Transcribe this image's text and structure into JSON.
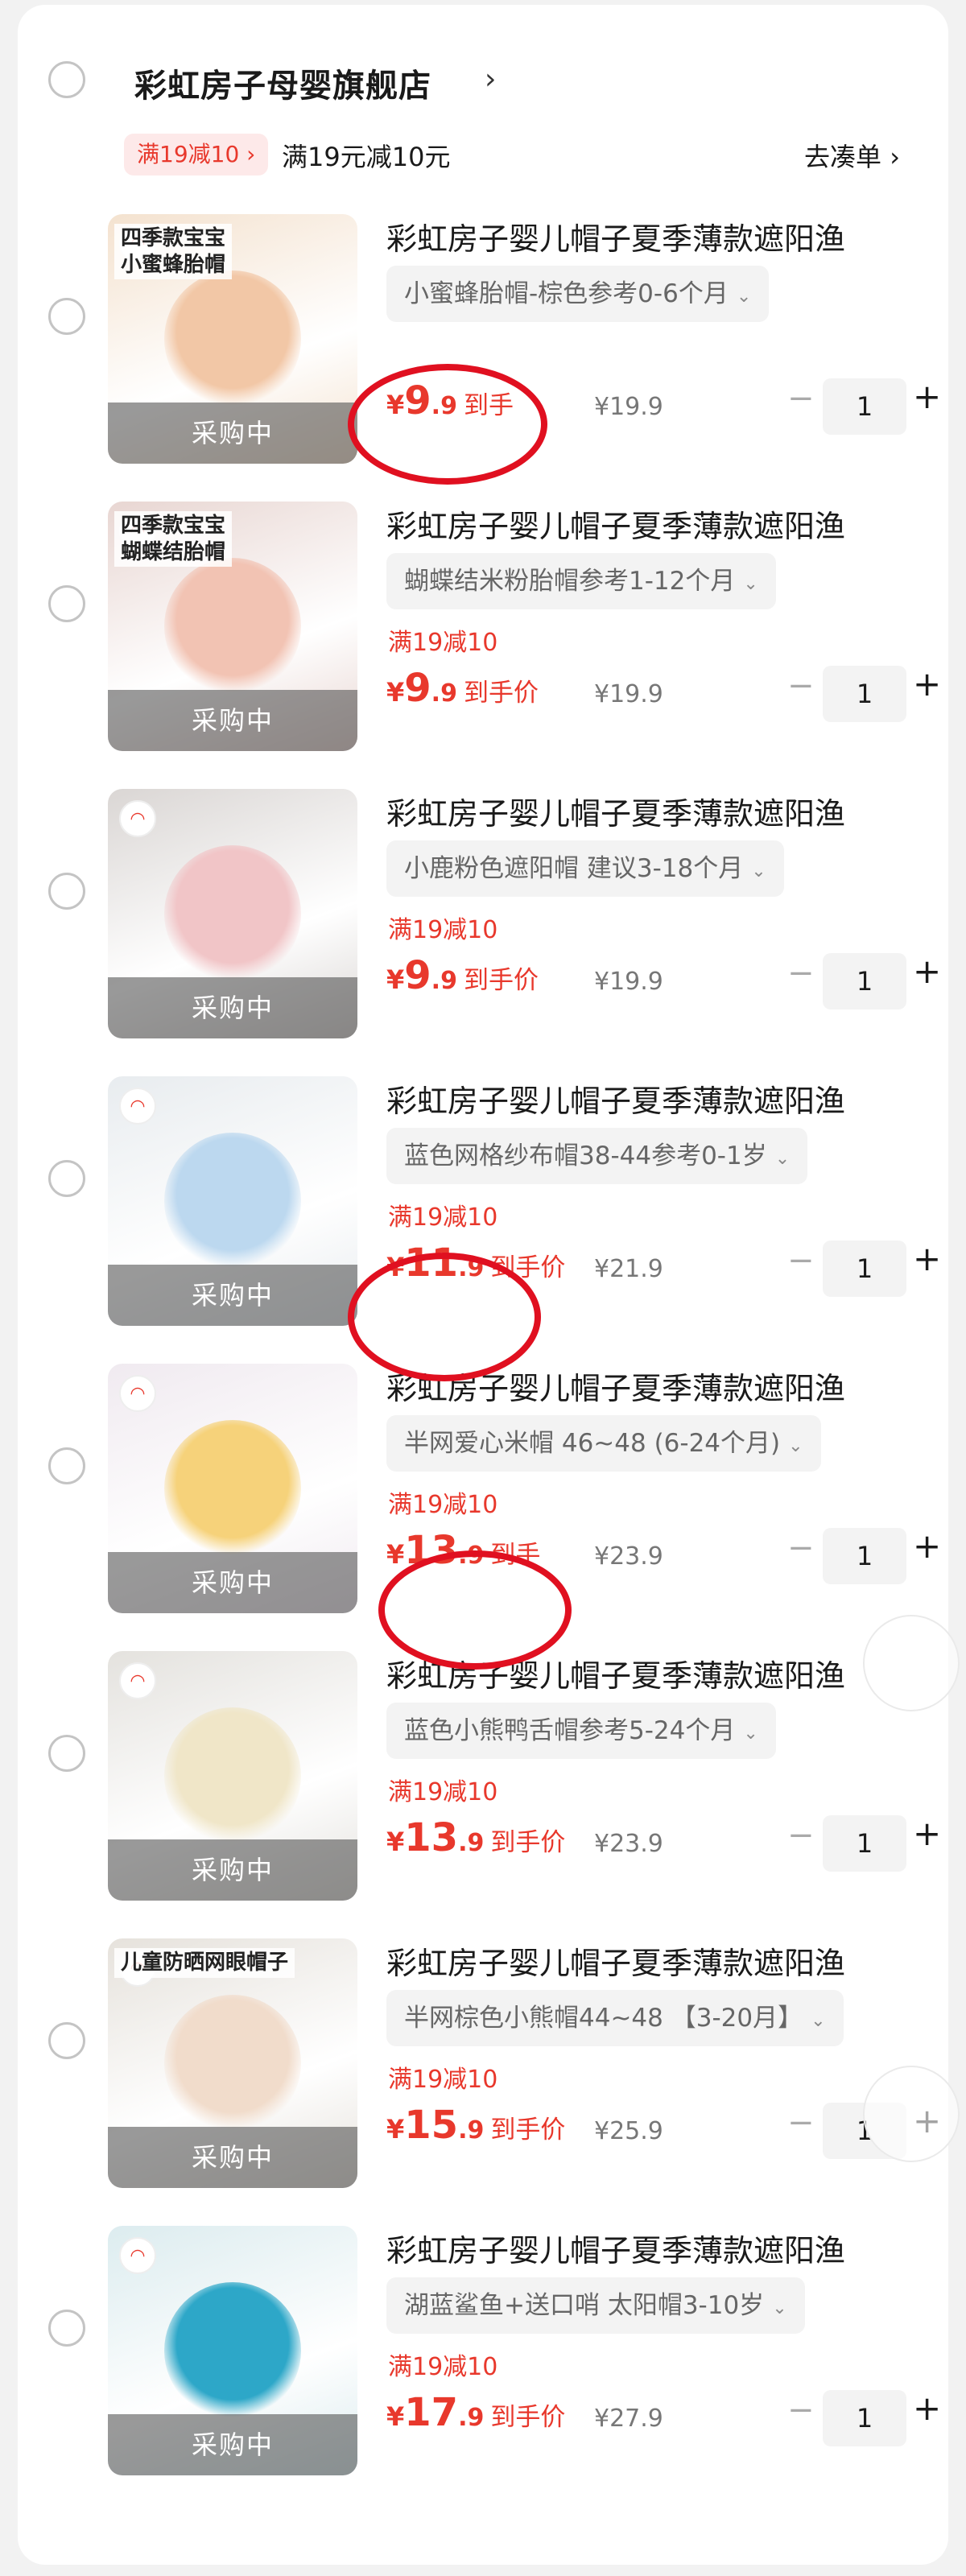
{
  "store": {
    "name": "彩虹房子母婴旗舰店",
    "chevron": "›",
    "promo_badge": "满19减10 ›",
    "promo_text": "满19元减10元",
    "gather_label": "去凑单 ›"
  },
  "colors": {
    "accent": "#e8382c",
    "annotation_red": "#e01020"
  },
  "items": [
    {
      "title": "彩虹房子婴儿帽子夏季薄款遮阳渔",
      "variant": "小蜜蜂胎帽-棕色参考0-6个月",
      "thumb_caption": "四季款宝宝\n小蜜蜂胎帽",
      "thumb_status": "采购中",
      "discount": "",
      "price_yen": "¥",
      "price_int": "9",
      "price_dec": ".9",
      "price_label": "到手",
      "orig_price": "¥19.9",
      "qty": "1"
    },
    {
      "title": "彩虹房子婴儿帽子夏季薄款遮阳渔",
      "variant": "蝴蝶结米粉胎帽参考1-12个月",
      "thumb_caption": "四季款宝宝\n蝴蝶结胎帽",
      "thumb_status": "采购中",
      "discount": "满19减10",
      "price_yen": "¥",
      "price_int": "9",
      "price_dec": ".9",
      "price_label": "到手价",
      "orig_price": "¥19.9",
      "qty": "1"
    },
    {
      "title": "彩虹房子婴儿帽子夏季薄款遮阳渔",
      "variant": "小鹿粉色遮阳帽 建议3-18个月",
      "thumb_caption": "",
      "thumb_status": "采购中",
      "discount": "满19减10",
      "price_yen": "¥",
      "price_int": "9",
      "price_dec": ".9",
      "price_label": "到手价",
      "orig_price": "¥19.9",
      "qty": "1"
    },
    {
      "title": "彩虹房子婴儿帽子夏季薄款遮阳渔",
      "variant": "蓝色网格纱布帽38-44参考0-1岁",
      "thumb_caption": "",
      "thumb_status": "采购中",
      "discount": "满19减10",
      "price_yen": "¥",
      "price_int": "11",
      "price_dec": ".9",
      "price_label": "到手价",
      "orig_price": "¥21.9",
      "qty": "1"
    },
    {
      "title": "彩虹房子婴儿帽子夏季薄款遮阳渔",
      "variant": "半网爱心米帽 46~48 (6-24个月)",
      "thumb_caption": "",
      "thumb_status": "采购中",
      "discount": "满19减10",
      "price_yen": "¥",
      "price_int": "13",
      "price_dec": ".9",
      "price_label": "到手",
      "orig_price": "¥23.9",
      "qty": "1"
    },
    {
      "title": "彩虹房子婴儿帽子夏季薄款遮阳渔",
      "variant": "蓝色小熊鸭舌帽参考5-24个月",
      "thumb_caption": "",
      "thumb_status": "采购中",
      "discount": "满19减10",
      "price_yen": "¥",
      "price_int": "13",
      "price_dec": ".9",
      "price_label": "到手价",
      "orig_price": "¥23.9",
      "qty": "1"
    },
    {
      "title": "彩虹房子婴儿帽子夏季薄款遮阳渔",
      "variant": "半网棕色小熊帽44~48 【3-20月】",
      "thumb_caption": "儿童防晒网眼帽子",
      "thumb_status": "采购中",
      "discount": "满19减10",
      "price_yen": "¥",
      "price_int": "15",
      "price_dec": ".9",
      "price_label": "到手价",
      "orig_price": "¥25.9",
      "qty": "1"
    },
    {
      "title": "彩虹房子婴儿帽子夏季薄款遮阳渔",
      "variant": "湖蓝鲨鱼+送口哨 太阳帽3-10岁",
      "thumb_caption": "",
      "thumb_status": "采购中",
      "discount": "满19减10",
      "price_yen": "¥",
      "price_int": "17",
      "price_dec": ".9",
      "price_label": "到手价",
      "orig_price": "¥27.9",
      "qty": "1"
    }
  ]
}
